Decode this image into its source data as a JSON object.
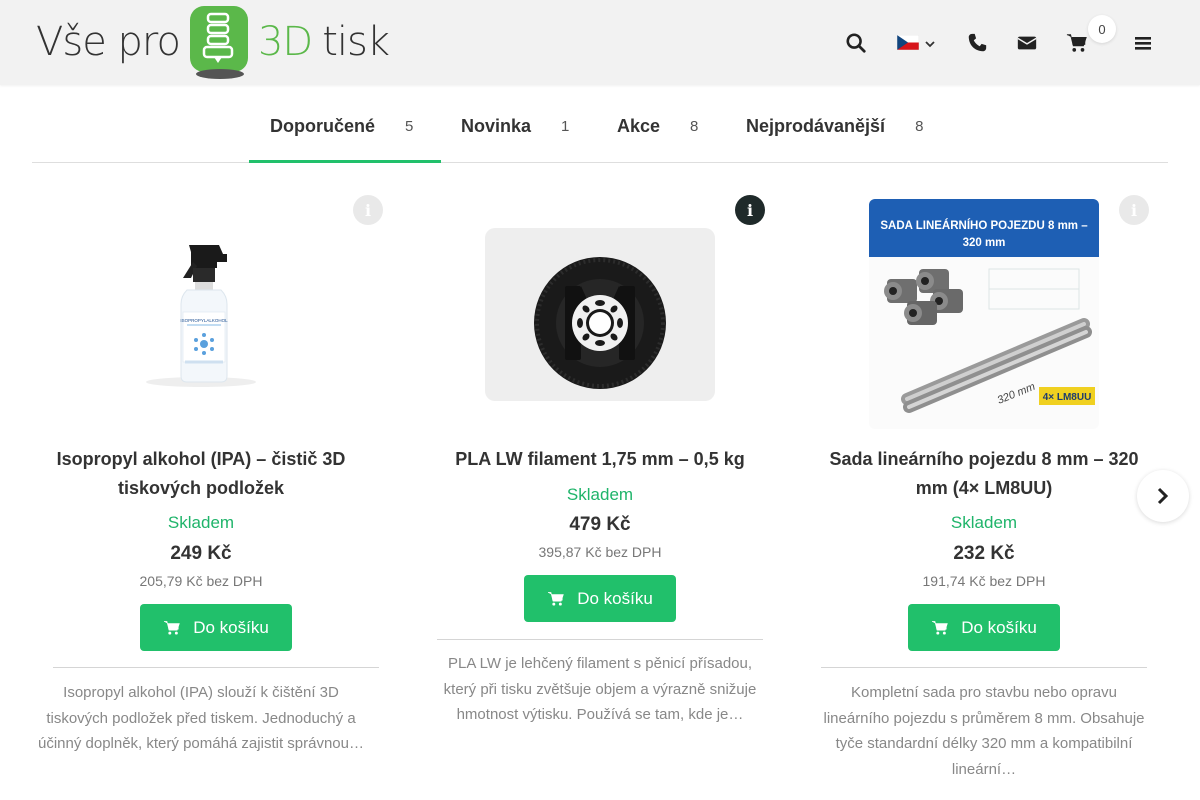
{
  "logo": {
    "part1": "Vše pro",
    "part2": "3D",
    "part3": "tisk"
  },
  "header": {
    "cart_count": "0",
    "icons": [
      "search-icon",
      "flag-cz-icon",
      "phone-icon",
      "email-icon",
      "cart-icon",
      "menu-icon"
    ]
  },
  "tabs": [
    {
      "label": "Doporučené",
      "count": "5",
      "active": true
    },
    {
      "label": "Novinka",
      "count": "1",
      "active": false
    },
    {
      "label": "Akce",
      "count": "8",
      "active": false
    },
    {
      "label": "Nejprodávanější",
      "count": "8",
      "active": false
    }
  ],
  "products": [
    {
      "title": "Isopropyl alkohol (IPA) – čistič 3D tiskových podložek",
      "stock": "Skladem",
      "price": "249 Kč",
      "price_net": "205,79 Kč bez DPH",
      "button": "Do košíku",
      "description": "Isopropyl alkohol (IPA) slouží k čištění 3D tiskových podložek před tiskem. Jednoduchý a účinný doplněk, který pomáhá zajistit správnou…",
      "bottle_label": "ISOPROPYLALKOHOL"
    },
    {
      "title": "PLA LW filament 1,75 mm – 0,5 kg",
      "stock": "Skladem",
      "price": "479 Kč",
      "price_net": "395,87 Kč bez DPH",
      "button": "Do košíku",
      "description": "PLA LW je lehčený filament s pěnicí přísadou, který při tisku zvětšuje objem a výrazně snižuje hmotnost výtisku. Používá se tam, kde je…"
    },
    {
      "title": "Sada lineárního pojezdu 8 mm – 320 mm (4× LM8UU)",
      "stock": "Skladem",
      "price": "232 Kč",
      "price_net": "191,74 Kč bez DPH",
      "button": "Do košíku",
      "description": "Kompletní sada pro stavbu nebo opravu lineárního pojezdu s průměrem 8 mm. Obsahuje tyče standardní délky 320 mm a kompatibilní lineární…",
      "banner_line1": "SADA LINEÁRNÍHO POJEZDU 8 mm –",
      "banner_line2": "320 mm",
      "rod_label": "320 mm",
      "badge": "4× LM8UU"
    }
  ],
  "colors": {
    "accent": "#21c06b",
    "stock": "#1fb46a",
    "banner": "#1e5fb4"
  }
}
